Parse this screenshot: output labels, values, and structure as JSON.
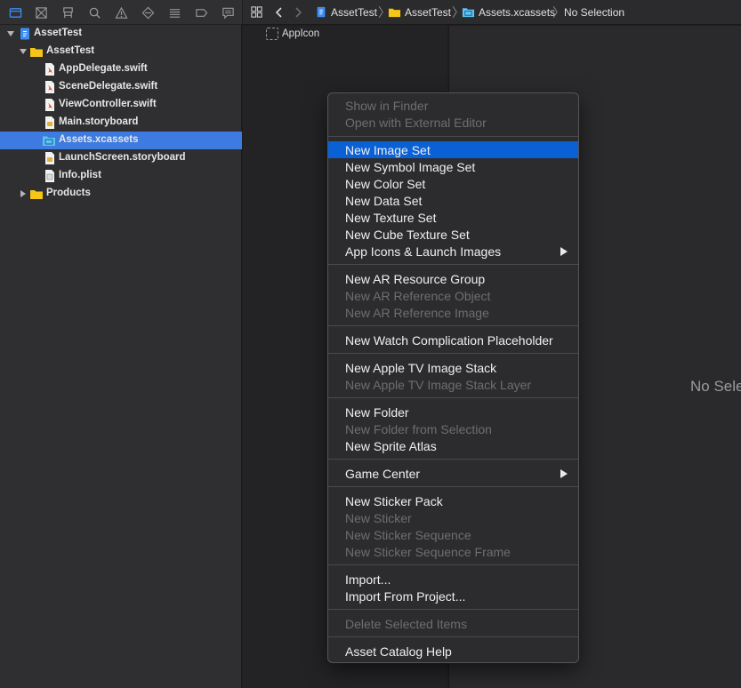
{
  "navigator": {
    "toolbar_icons": [
      "folder-icon",
      "source-control-icon",
      "symbol-icon",
      "find-icon",
      "issue-icon",
      "test-icon",
      "debug-icon",
      "breakpoint-icon",
      "report-icon"
    ],
    "items": [
      {
        "label": "AssetTest",
        "icon": "project-icon"
      },
      {
        "label": "AssetTest",
        "icon": "folder-icon"
      },
      {
        "label": "AppDelegate.swift",
        "icon": "swift-file-icon"
      },
      {
        "label": "SceneDelegate.swift",
        "icon": "swift-file-icon"
      },
      {
        "label": "ViewController.swift",
        "icon": "swift-file-icon"
      },
      {
        "label": "Main.storyboard",
        "icon": "storyboard-file-icon"
      },
      {
        "label": "Assets.xcassets",
        "icon": "asset-catalog-icon"
      },
      {
        "label": "LaunchScreen.storyboard",
        "icon": "storyboard-file-icon"
      },
      {
        "label": "Info.plist",
        "icon": "plist-file-icon"
      },
      {
        "label": "Products",
        "icon": "folder-icon"
      }
    ]
  },
  "jumpbar": {
    "crumbs": [
      "AssetTest",
      "AssetTest",
      "Assets.xcassets",
      "No Selection"
    ]
  },
  "asset_list": {
    "items": [
      "AppIcon"
    ]
  },
  "detail": {
    "empty_text": "No Selection"
  },
  "menu": {
    "items": [
      {
        "label": "Show in Finder",
        "enabled": false
      },
      {
        "label": "Open with External Editor",
        "enabled": false
      },
      {
        "label": "New Image Set",
        "enabled": true,
        "highlighted": true
      },
      {
        "label": "New Symbol Image Set",
        "enabled": true
      },
      {
        "label": "New Color Set",
        "enabled": true
      },
      {
        "label": "New Data Set",
        "enabled": true
      },
      {
        "label": "New Texture Set",
        "enabled": true
      },
      {
        "label": "New Cube Texture Set",
        "enabled": true
      },
      {
        "label": "App Icons & Launch Images",
        "enabled": true,
        "submenu": true
      },
      {
        "label": "New AR Resource Group",
        "enabled": true
      },
      {
        "label": "New AR Reference Object",
        "enabled": false
      },
      {
        "label": "New AR Reference Image",
        "enabled": false
      },
      {
        "label": "New Watch Complication Placeholder",
        "enabled": true
      },
      {
        "label": "New Apple TV Image Stack",
        "enabled": true
      },
      {
        "label": "New Apple TV Image Stack Layer",
        "enabled": false
      },
      {
        "label": "New Folder",
        "enabled": true
      },
      {
        "label": "New Folder from Selection",
        "enabled": false
      },
      {
        "label": "New Sprite Atlas",
        "enabled": true
      },
      {
        "label": "Game Center",
        "enabled": true,
        "submenu": true
      },
      {
        "label": "New Sticker Pack",
        "enabled": true
      },
      {
        "label": "New Sticker",
        "enabled": false
      },
      {
        "label": "New Sticker Sequence",
        "enabled": false
      },
      {
        "label": "New Sticker Sequence Frame",
        "enabled": false
      },
      {
        "label": "Import...",
        "enabled": true
      },
      {
        "label": "Import From Project...",
        "enabled": true
      },
      {
        "label": "Delete Selected Items",
        "enabled": false
      },
      {
        "label": "Asset Catalog Help",
        "enabled": true
      }
    ]
  },
  "colors": {
    "selection": "#3d7be0",
    "menu_highlight": "#0a61d6",
    "folder": "#f5c518"
  }
}
